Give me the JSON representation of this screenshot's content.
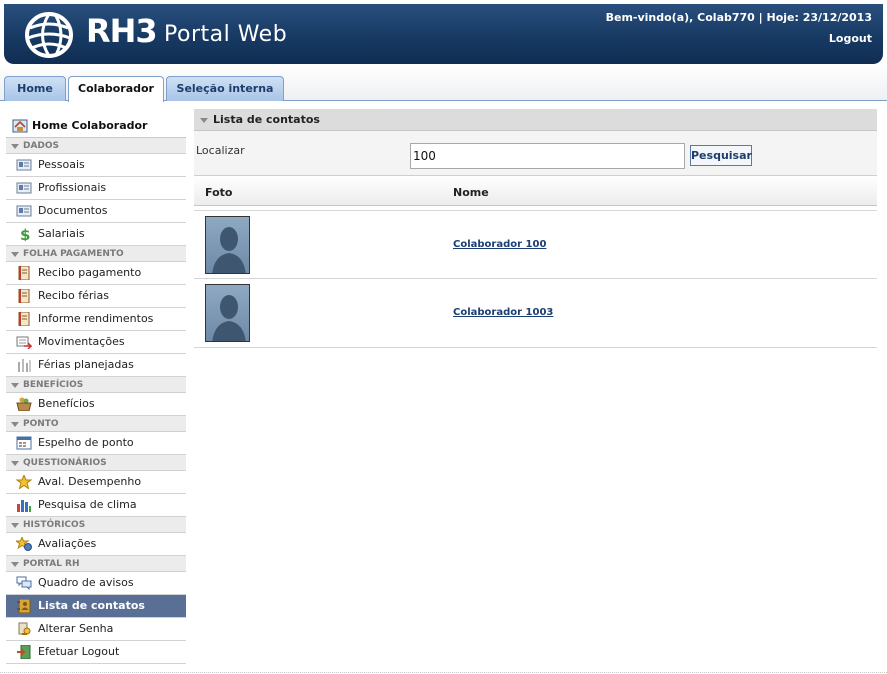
{
  "header": {
    "brand_main": "RH3",
    "brand_sub": "Portal Web",
    "welcome": "Bem-vindo(a), Colab770 | Hoje: 23/12/2013",
    "logout": "Logout"
  },
  "tabs": [
    "Home",
    "Colaborador",
    "Seleção interna"
  ],
  "active_tab": "Colaborador",
  "sidebar": {
    "home": "Home Colaborador",
    "sections": [
      {
        "title": "DADOS",
        "items": [
          {
            "label": "Pessoais",
            "icon": "id-card-icon"
          },
          {
            "label": "Profissionais",
            "icon": "id-card-icon"
          },
          {
            "label": "Documentos",
            "icon": "id-card-icon"
          },
          {
            "label": "Salariais",
            "icon": "dollar-icon"
          }
        ]
      },
      {
        "title": "FOLHA PAGAMENTO",
        "items": [
          {
            "label": "Recibo pagamento",
            "icon": "notebook-icon"
          },
          {
            "label": "Recibo férias",
            "icon": "notebook-icon"
          },
          {
            "label": "Informe rendimentos",
            "icon": "notebook-icon"
          },
          {
            "label": "Movimentações",
            "icon": "transfer-icon"
          },
          {
            "label": "Férias planejadas",
            "icon": "calendar-bars-icon"
          }
        ]
      },
      {
        "title": "BENEFÍCIOS",
        "items": [
          {
            "label": "Benefícios",
            "icon": "basket-icon"
          }
        ]
      },
      {
        "title": "PONTO",
        "items": [
          {
            "label": "Espelho de ponto",
            "icon": "calendar-icon"
          }
        ]
      },
      {
        "title": "QUESTIONÁRIOS",
        "items": [
          {
            "label": "Aval. Desempenho",
            "icon": "star-icon"
          },
          {
            "label": "Pesquisa de clima",
            "icon": "bar-chart-icon"
          }
        ]
      },
      {
        "title": "HISTÓRICOS",
        "items": [
          {
            "label": "Avaliações",
            "icon": "star-medal-icon"
          }
        ]
      },
      {
        "title": "PORTAL RH",
        "items": [
          {
            "label": "Quadro de avisos",
            "icon": "speech-bubbles-icon"
          },
          {
            "label": "Lista de contatos",
            "icon": "address-book-icon",
            "active": true
          },
          {
            "label": "Alterar Senha",
            "icon": "key-icon"
          },
          {
            "label": "Efetuar Logout",
            "icon": "exit-icon"
          }
        ]
      }
    ]
  },
  "contacts": {
    "title": "Lista de contatos",
    "search_label": "Localizar",
    "search_value": "100",
    "search_button": "Pesquisar",
    "columns": [
      "Foto",
      "Nome"
    ],
    "rows": [
      {
        "name": "Colaborador 100"
      },
      {
        "name": "Colaborador 1003"
      }
    ]
  },
  "colors": {
    "header_bg": "#173a63",
    "tab_bg": "#a7c4e7",
    "active_menu_bg": "#5a6f96",
    "link": "#1a3f74"
  }
}
